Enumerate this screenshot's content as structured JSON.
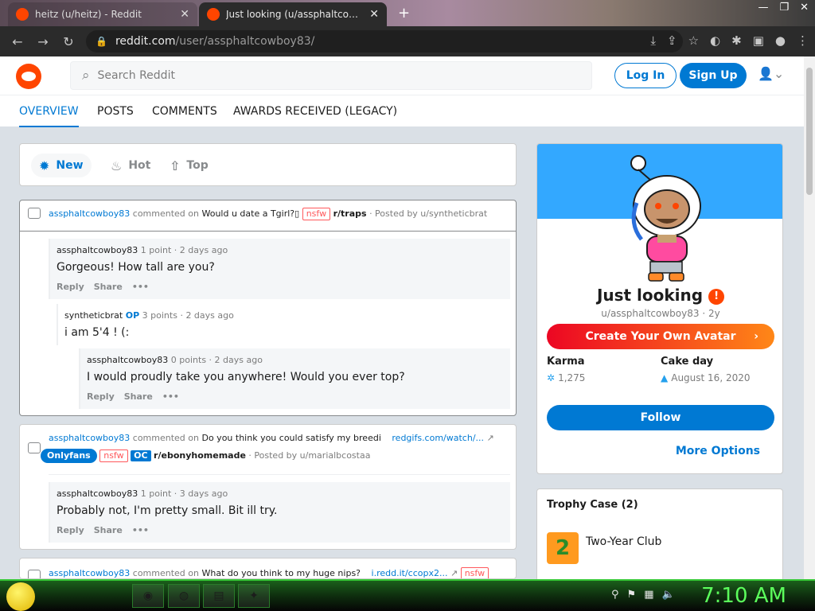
{
  "browser": {
    "tabs": [
      {
        "title": "heitz (u/heitz) - Reddit",
        "active": false
      },
      {
        "title": "Just looking (u/assphaltcowboy83)",
        "active": true
      }
    ],
    "url_domain": "reddit.com",
    "url_path": "/user/assphaltcowboy83/"
  },
  "header": {
    "search_placeholder": "Search Reddit",
    "login_label": "Log In",
    "signup_label": "Sign Up"
  },
  "profile_tabs": [
    "OVERVIEW",
    "POSTS",
    "COMMENTS",
    "AWARDS RECEIVED (LEGACY)"
  ],
  "sort": [
    {
      "label": "New",
      "active": true
    },
    {
      "label": "Hot",
      "active": false
    },
    {
      "label": "Top",
      "active": false
    }
  ],
  "feed": [
    {
      "header": {
        "user": "assphaltcowboy83",
        "verb": "commented on",
        "title": "Would u date a Tgirl?▯",
        "flair": "nsfw",
        "sub": "r/traps",
        "posted_by": "· Posted by u/syntheticbrat"
      },
      "comments": [
        {
          "user": "assphaltcowboy83",
          "op": "",
          "meta": "1 point · 2 days ago",
          "body": "Gorgeous! How tall are you?",
          "reply": "Reply",
          "share": "Share"
        },
        {
          "user": "syntheticbrat",
          "op": "OP",
          "meta": "3 points · 2 days ago",
          "body": "i am 5'4 ! (:",
          "reply": "",
          "share": ""
        },
        {
          "user": "assphaltcowboy83",
          "op": "",
          "meta": "0 points · 2 days ago",
          "body": "I would proudly take you anywhere! Would you ever top?",
          "reply": "Reply",
          "share": "Share"
        }
      ]
    },
    {
      "header": {
        "user": "assphaltcowboy83",
        "verb": "commented on",
        "title": "Do you think you could satisfy my breedi",
        "link": "redgifs.com/watch/...",
        "flair1": "Onlyfans",
        "flair2": "nsfw",
        "flair3": "OC",
        "sub": "r/ebonyhomemade",
        "posted_by": "· Posted by u/marialbcostaa"
      },
      "comments": [
        {
          "user": "assphaltcowboy83",
          "op": "",
          "meta": "1 point · 3 days ago",
          "body": "Probably not, I'm pretty small. Bit ill try.",
          "reply": "Reply",
          "share": "Share"
        }
      ]
    },
    {
      "header": {
        "user": "assphaltcowboy83",
        "verb": "commented on",
        "title": "What do you think to my huge nips?",
        "link": "i.redd.it/ccopx2...",
        "flair": "nsfw"
      }
    }
  ],
  "sidebar": {
    "display_name": "Just looking",
    "handle": "u/assphaltcowboy83 · 2y",
    "avatar_button": "Create Your Own Avatar",
    "karma_label": "Karma",
    "karma_value": "1,275",
    "cakeday_label": "Cake day",
    "cakeday_value": "August 16, 2020",
    "follow_label": "Follow",
    "more_options": "More Options",
    "trophy_header": "Trophy Case (2)",
    "trophy_name": "Two-Year Club"
  },
  "taskbar": {
    "clock": "7:10 AM"
  },
  "colors": {
    "accent": "#0079d3",
    "reddit_orange": "#ff4500",
    "nsfw": "#ff585b"
  }
}
